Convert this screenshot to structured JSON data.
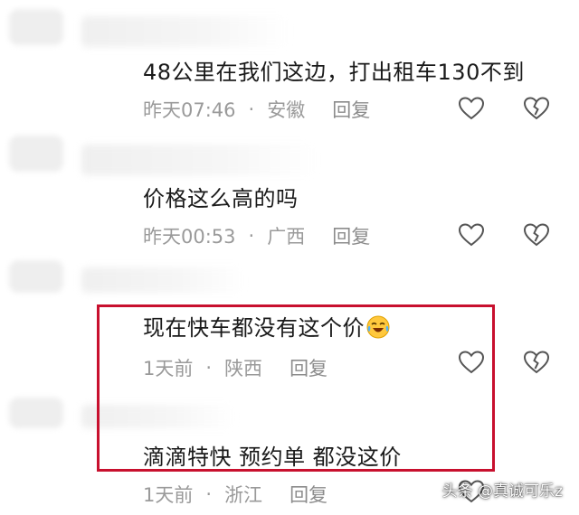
{
  "comments": [
    {
      "text": "48公里在我们这边，打出租车130不到",
      "time": "昨天07:46",
      "separator": "·",
      "location": "安徽",
      "reply_label": "回复"
    },
    {
      "text": "价格这么高的吗",
      "time": "昨天00:53",
      "separator": "·",
      "location": "广西",
      "reply_label": "回复"
    },
    {
      "text": "现在快车都没有这个价",
      "time": "1天前",
      "separator": "·",
      "location": "陕西",
      "reply_label": "回复",
      "emoji": "laughing-crying-emoji"
    },
    {
      "text": "滴滴特快  预约单  都没这价",
      "time": "1天前",
      "separator": "·",
      "location": "浙江",
      "reply_label": "回复"
    }
  ],
  "highlight_color": "#c8102e",
  "watermark": "头条 @真诚可乐z"
}
